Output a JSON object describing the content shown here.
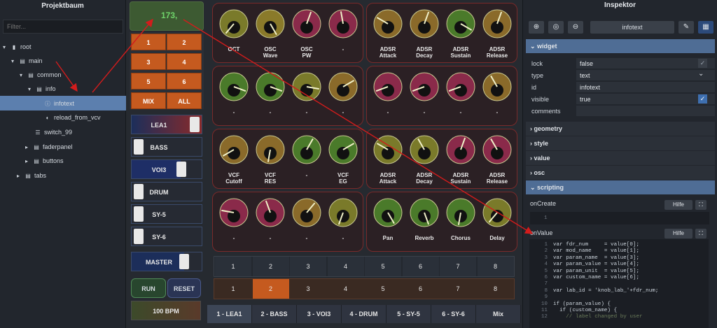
{
  "tree": {
    "title": "Projektbaum",
    "filter_placeholder": "Filter...",
    "nodes": [
      "root",
      "main",
      "common",
      "info",
      "infotext",
      "reload_from_vcv",
      "switch_99",
      "faderpanel",
      "buttons",
      "tabs"
    ]
  },
  "center": {
    "value_label": "173,",
    "pads": [
      "1",
      "2",
      "3",
      "4",
      "5",
      "6",
      "MIX",
      "ALL"
    ],
    "channels": [
      "LEA1",
      "BASS",
      "VOI3",
      "DRUM",
      "SY-5",
      "SY-6",
      "MASTER"
    ],
    "run": "RUN",
    "reset": "RESET",
    "bpm": "100 BPM",
    "knob_labels": [
      [
        "OCT",
        "OSC\nWave",
        "OSC\nPW",
        "-",
        "ADSR\nAttack",
        "ADSR\nDecay",
        "ADSR\nSustain",
        "ADSR\nRelease"
      ],
      [
        "-",
        "-",
        "-",
        "-",
        "-",
        "-",
        "-",
        "-"
      ],
      [
        "VCF\nCutoff",
        "VCF\nRES",
        "-",
        "VCF\nEG",
        "ADSR\nAttack",
        "ADSR\nDecay",
        "ADSR\nSustain",
        "ADSR\nRelease"
      ],
      [
        "-",
        "-",
        "-",
        "-",
        "Pan",
        "Reverb",
        "Chorus",
        "Delay"
      ]
    ],
    "steps_top": [
      "1",
      "2",
      "3",
      "4",
      "5",
      "6",
      "7",
      "8"
    ],
    "steps_bottom": [
      "1",
      "2",
      "3",
      "4",
      "5",
      "6",
      "7",
      "8"
    ],
    "tabs": [
      "1 - LEA1",
      "2 - BASS",
      "3 - VOI3",
      "4 - DRUM",
      "5 - SY-5",
      "6 - SY-6",
      "Mix"
    ]
  },
  "inspector": {
    "title": "Inspektor",
    "widget_id": "infotext",
    "sections": [
      "widget",
      "geometry",
      "style",
      "value",
      "osc",
      "scripting"
    ],
    "props": [
      {
        "k": "lock",
        "v": "false"
      },
      {
        "k": "type",
        "v": "text"
      },
      {
        "k": "id",
        "v": "infotext"
      },
      {
        "k": "visible",
        "v": "true"
      },
      {
        "k": "comments",
        "v": ""
      }
    ],
    "oncreate": "onCreate",
    "onvalue": "onValue",
    "hilfe": "Hilfe",
    "oncreate_line": "1",
    "code": [
      {
        "n": "1",
        "t": "var fdr_num     = value[0];"
      },
      {
        "n": "2",
        "t": "var mod_name    = value[1];"
      },
      {
        "n": "3",
        "t": "var param_name  = value[3];"
      },
      {
        "n": "4",
        "t": "var param_value = value[4];"
      },
      {
        "n": "5",
        "t": "var param_unit  = value[5];"
      },
      {
        "n": "6",
        "t": "var custom_name = value[6];"
      },
      {
        "n": "7",
        "t": ""
      },
      {
        "n": "8",
        "t": "var lab_id = 'knob_lab_'+fdr_num;"
      },
      {
        "n": "9",
        "t": ""
      },
      {
        "n": "10",
        "t": "if (param_value) {"
      },
      {
        "n": "11",
        "t": "  if (custom_name) {"
      },
      {
        "n": "12",
        "t": "    // label changed by user"
      }
    ]
  },
  "colors": {
    "accent": "#5c7fae",
    "pad": "#c55a1f",
    "arrow": "#d21c1c"
  }
}
